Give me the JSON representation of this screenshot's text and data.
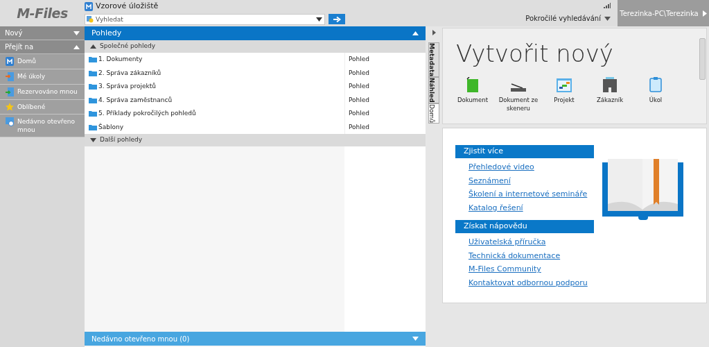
{
  "header": {
    "logo": "M-Files",
    "vault": "Vzorové úložiště",
    "search": {
      "placeholder": "Vyhledat"
    },
    "advanced_search": "Pokročilé vyhledávání",
    "user": "Terezinka-PC\\Terezinka"
  },
  "sidebar": {
    "sections": [
      {
        "label": "Nový",
        "expanded": false
      },
      {
        "label": "Přejít na",
        "expanded": true
      }
    ],
    "items": [
      {
        "label": "Domů",
        "kind": "home"
      },
      {
        "label": "Mé úkoly",
        "kind": "tasks"
      },
      {
        "label": "Rezervováno mnou",
        "kind": "checked-out"
      },
      {
        "label": "Oblíbené",
        "kind": "favorites"
      },
      {
        "label": "Nedávno otevřeno mnou",
        "kind": "recent"
      }
    ]
  },
  "views": {
    "title": "Pohledy",
    "expanded": true,
    "groups": [
      {
        "label": "Společné pohledy",
        "expanded": true,
        "rows": [
          {
            "name": "1. Dokumenty",
            "type": "Pohled"
          },
          {
            "name": "2. Správa zákazníků",
            "type": "Pohled"
          },
          {
            "name": "3. Správa projektů",
            "type": "Pohled"
          },
          {
            "name": "4. Správa zaměstnanců",
            "type": "Pohled"
          },
          {
            "name": "5. Příklady pokročilých pohledů",
            "type": "Pohled"
          },
          {
            "name": "Šablony",
            "type": "Pohled"
          }
        ]
      },
      {
        "label": "Další pohledy",
        "expanded": false
      }
    ],
    "footer": {
      "label": "Nedávno otevřeno mnou (0)",
      "expanded": false
    }
  },
  "side_tabs": [
    {
      "label": "Metadata",
      "selected": false
    },
    {
      "label": "Náhled",
      "selected": false
    },
    {
      "label": "Domů",
      "selected": true
    }
  ],
  "create_new": {
    "title": "Vytvořit nový",
    "items": [
      {
        "label": "Dokument",
        "kind": "document"
      },
      {
        "label": "Dokument ze skeneru",
        "kind": "scanner"
      },
      {
        "label": "Projekt",
        "kind": "project"
      },
      {
        "label": "Zákazník",
        "kind": "customer"
      },
      {
        "label": "Úkol",
        "kind": "task"
      }
    ]
  },
  "help": {
    "sections": [
      {
        "title": "Zjistit více",
        "links": [
          "Přehledové video",
          "Seznámení",
          "Školení a internetové semináře",
          "Katalog řešení"
        ]
      },
      {
        "title": "Získat nápovědu",
        "links": [
          "Uživatelská příručka",
          "Technická dokumentace",
          "M-Files Community",
          "Kontaktovat odbornou podporu"
        ]
      }
    ]
  }
}
